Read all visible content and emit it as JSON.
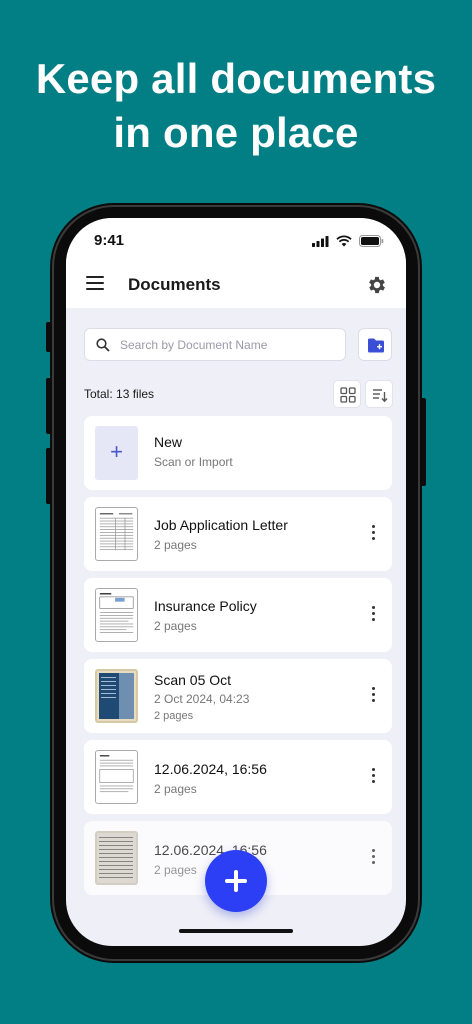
{
  "headline": {
    "line1": "Keep all documents",
    "line2": "in one place"
  },
  "status_bar": {
    "time": "9:41"
  },
  "app_bar": {
    "title": "Documents"
  },
  "search": {
    "placeholder": "Search by Document Name"
  },
  "list": {
    "total_label": "Total: 13 files",
    "new_item": {
      "title": "New",
      "subtitle": "Scan or Import"
    },
    "documents": [
      {
        "title": "Job Application Letter",
        "pages": "2 pages"
      },
      {
        "title": "Insurance Policy",
        "pages": "2 pages"
      },
      {
        "title": "Scan 05 Oct",
        "date": "2 Oct 2024, 04:23",
        "pages": "2 pages"
      },
      {
        "title": "12.06.2024, 16:56",
        "pages": "2 pages"
      },
      {
        "title": "12.06.2024, 16:56",
        "pages": "2 pages"
      }
    ]
  },
  "colors": {
    "background": "#017f84",
    "fab": "#2d3ff5",
    "accent": "#4a55c8"
  }
}
